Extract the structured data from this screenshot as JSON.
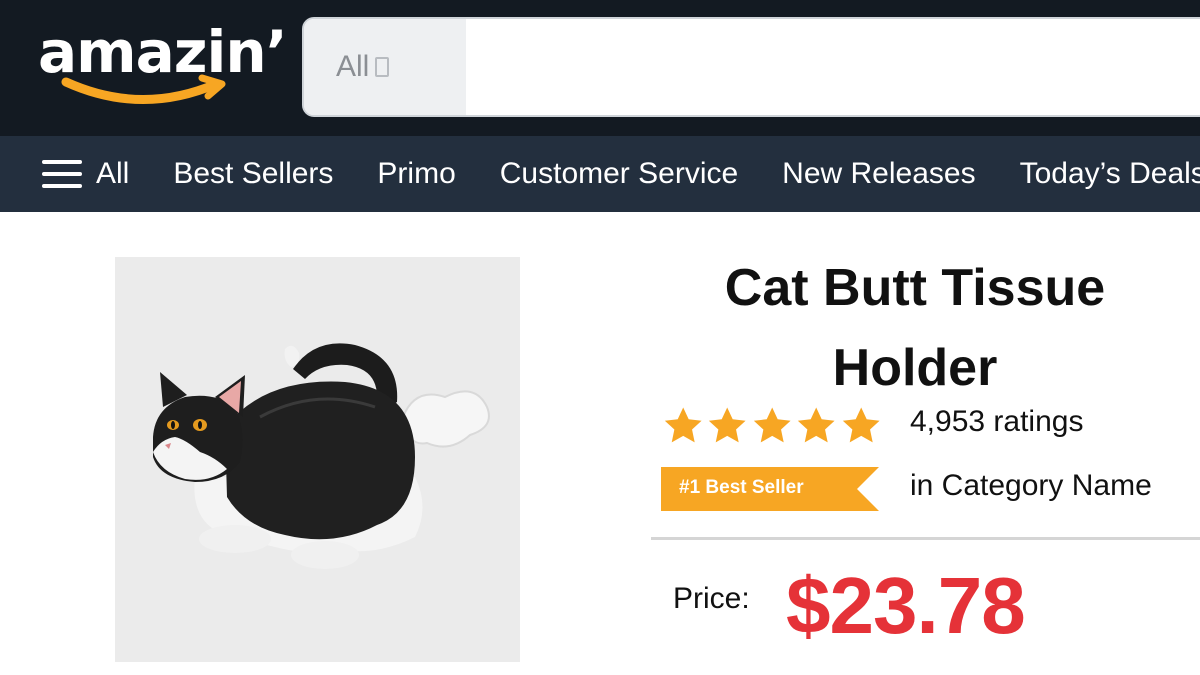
{
  "header": {
    "logo_text": "amazin’",
    "search": {
      "category_label": "All",
      "category_icon": "chevron-down-icon",
      "placeholder": "",
      "value": ""
    }
  },
  "nav": {
    "all_label": "All",
    "menu_icon": "hamburger-menu-icon",
    "links": [
      "Best Sellers",
      "Primo",
      "Customer Service",
      "New Releases",
      "Today’s Deals"
    ]
  },
  "product": {
    "title": "Cat Butt Tissue Holder",
    "image_description_icon": "cat-tissue-holder-image",
    "rating": {
      "stars": 5,
      "max": 5,
      "count_text": "4,953 ratings"
    },
    "badge": {
      "text": "#1 Best Seller",
      "category_text": "in Category Name"
    },
    "price_label": "Price:",
    "price": "$23.78"
  },
  "colors": {
    "header_bg": "#131a22",
    "nav_bg": "#232f3e",
    "star": "#f7a623",
    "badge": "#f7a623",
    "price": "#e53238",
    "logo_smile": "#f7a623"
  }
}
